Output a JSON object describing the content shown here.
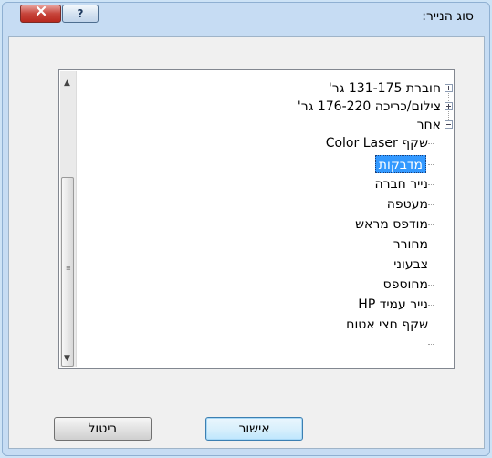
{
  "window": {
    "title": "סוג הנייר:",
    "close_icon": "close-icon",
    "help_label": "?"
  },
  "tree": {
    "nodes": [
      {
        "label": "חוברת 131-175 גר'",
        "expanded": false
      },
      {
        "label": "צילום/כריכה 176-220 גר'",
        "expanded": false
      },
      {
        "label": "אחר",
        "expanded": true
      }
    ],
    "children": [
      "שקף Color Laser",
      "מדבקות",
      "נייר חברה",
      "מעטפה",
      "מודפס מראש",
      "מחורר",
      "צבעוני",
      "מחוספס",
      "נייר עמיד HP",
      "שקף חצי אטום"
    ],
    "selected_index": 1
  },
  "buttons": {
    "ok": "אישור",
    "cancel": "ביטול"
  }
}
